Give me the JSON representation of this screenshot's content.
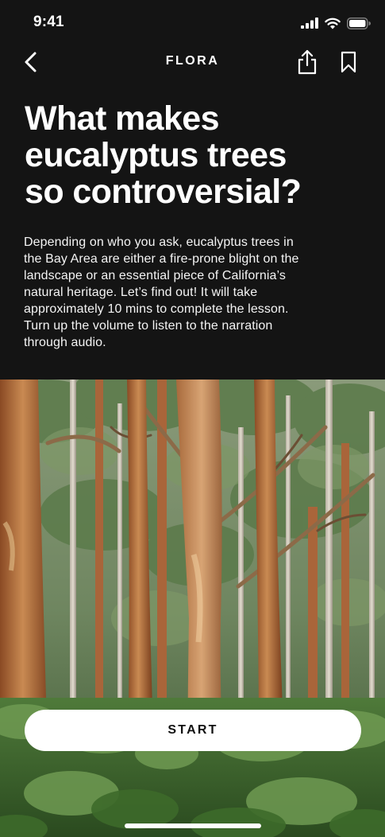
{
  "status_bar": {
    "time": "9:41",
    "icons": [
      "cellular-signal-icon",
      "wifi-icon",
      "battery-icon"
    ]
  },
  "nav": {
    "title": "FLORA",
    "back_icon": "chevron-left-icon",
    "share_icon": "share-icon",
    "bookmark_icon": "bookmark-icon"
  },
  "lesson": {
    "title_lines": [
      "What makes",
      "eucalyptus trees",
      "so controversial?"
    ],
    "description_lines": [
      "Depending on who you ask, eucalyptus trees in",
      "the Bay Area are either a fire-prone blight on the",
      "landscape or an essential piece of California’s",
      "natural heritage. Let’s find out! It will take",
      "approximately 10 mins to complete the lesson.",
      "Turn up the volume to listen to the narration",
      "through audio."
    ],
    "hero_image": "eucalyptus-forest-photo"
  },
  "actions": {
    "start_label": "START"
  },
  "colors": {
    "background": "#141414",
    "text": "#ffffff",
    "button_bg": "#ffffff",
    "button_text": "#111111"
  }
}
